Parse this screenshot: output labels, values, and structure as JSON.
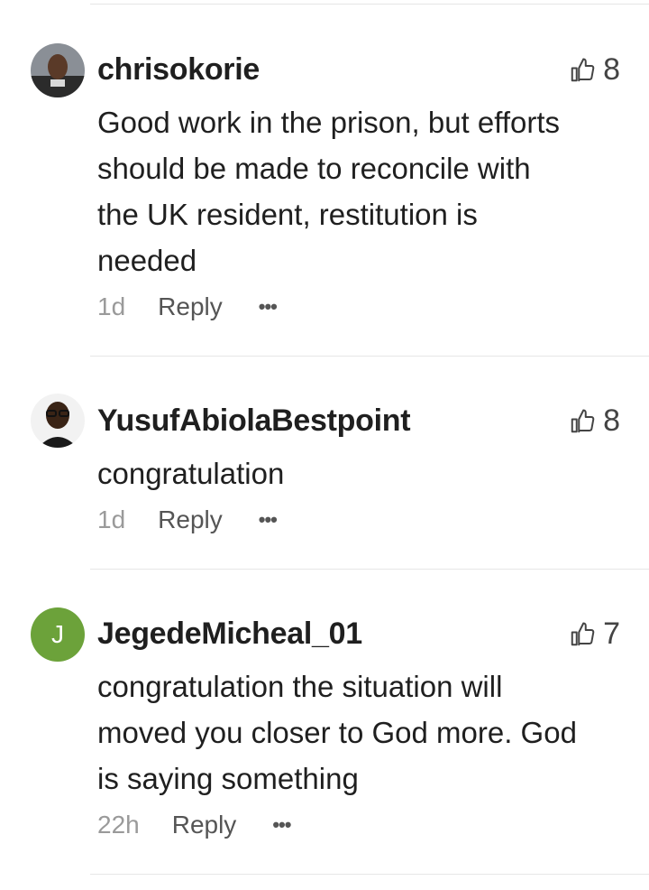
{
  "comments": [
    {
      "username": "chrisokorie",
      "avatar": "user-photo-avatar",
      "likes": "8",
      "text_lines": [
        "Good work in the prison, but efforts",
        "should be made to reconcile with",
        "the UK resident, restitution is",
        "needed"
      ],
      "time": "1d",
      "reply_label": "Reply",
      "more_label": "•••"
    },
    {
      "username": "YusufAbiolaBestpoint",
      "avatar": "user-photo-avatar",
      "likes": "8",
      "text_lines": [
        "congratulation"
      ],
      "time": "1d",
      "reply_label": "Reply",
      "more_label": "•••"
    },
    {
      "username": "JegedeMicheal_01",
      "avatar_letter": "J",
      "avatar_color": "#6ca23a",
      "likes": "7",
      "text_lines": [
        "congratulation the situation will",
        "moved you closer to God more. God",
        "is saying something"
      ],
      "time": "22h",
      "reply_label": "Reply",
      "more_label": "•••"
    }
  ],
  "icons": {
    "like": "thumbs-up-icon",
    "more": "more-options-icon"
  }
}
